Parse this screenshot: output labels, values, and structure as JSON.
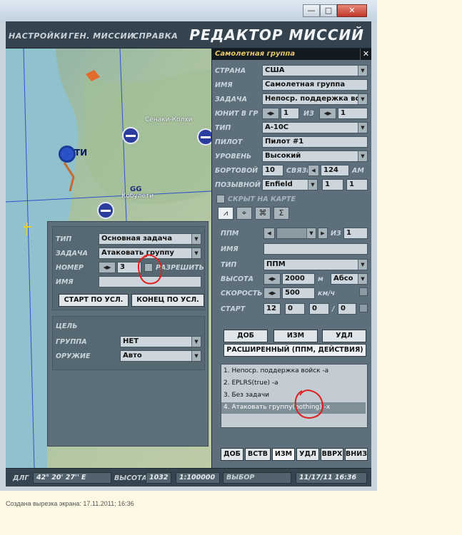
{
  "window": {
    "minimize": "—",
    "maximize": "□",
    "close": "✕"
  },
  "menu": {
    "items": [
      "НАСТРОЙКИ",
      "ГЕН. МИССИИ",
      "СПРАВКА"
    ],
    "title": "РЕДАКТОР МИССИЙ"
  },
  "map": {
    "towns": [
      "Сенаки-Колхи",
      "Кобулети"
    ],
    "airbase_code": "GG",
    "unit_code": "ТИ"
  },
  "group_panel": {
    "header": "Самолетная группа",
    "close": "✕",
    "country_label": "СТРАНА",
    "country": "США",
    "name_label": "ИМЯ",
    "name": "Самолетная группа",
    "task_label": "ЗАДАЧА",
    "task": "Непоср. поддержка войск",
    "unit_label": "ЮНИТ В ГР",
    "unit": "1",
    "of_label": "ИЗ",
    "of": "1",
    "type_label": "ТИП",
    "type": "A-10C",
    "pilot_label": "ПИЛОТ",
    "pilot": "Пилот #1",
    "level_label": "УРОВЕНЬ",
    "level": "Высокий",
    "board_label": "БОРТОВОЙ",
    "board": "10",
    "radio_label": "СВЯЗЬ",
    "radio": "124",
    "radio_unit": "AM",
    "callsign_label": "ПОЗЫВНОЙ",
    "callsign": "Enfield",
    "callsign_n1": "1",
    "callsign_n2": "1",
    "hidden_label": "СКРЫТ НА КАРТЕ",
    "tab_icons": [
      "⩘",
      "⌖",
      "⌘",
      "Σ"
    ]
  },
  "waypoint": {
    "wp_label": "ППМ",
    "of_label": "ИЗ",
    "of": "1",
    "name_label": "ИМЯ",
    "type_label": "ТИП",
    "type": "ППМ",
    "alt_label": "ВЫСОТА",
    "alt": "2000",
    "alt_unit": "м",
    "alt_mode": "Абсо",
    "speed_label": "СКОРОСТЬ",
    "speed": "500",
    "speed_unit": "км/ч",
    "start_label": "СТАРТ",
    "start_d": "12",
    "start_h": "0",
    "start_m": "0",
    "start_s": "0",
    "slash": "/"
  },
  "buttons": {
    "add": "ДОБ",
    "edit": "ИЗМ",
    "del": "УДЛ",
    "extended": "РАСШИРЕННЫЙ (ППМ, ДЕЙСТВИЯ)"
  },
  "actions": [
    "1. Непоср. поддержка войск -a",
    "2. EPLRS(true)  -a",
    "3. Без задачи",
    "4. Атаковать группу(nothing)  -x"
  ],
  "bottom_tabs": [
    "ДОБ",
    "ВСТВ",
    "ИЗМ",
    "УДЛ",
    "ВВРХ",
    "ВНИЗ"
  ],
  "action_panel": {
    "type_label": "ТИП",
    "type": "Основная задача",
    "task_label": "ЗАДАЧА",
    "task": "Атаковать группу",
    "number_label": "НОМЕР",
    "number": "3",
    "allow_label": "РАЗРЕШИТЬ",
    "name_label": "ИМЯ",
    "start_cond": "СТАРТ ПО УСЛ.",
    "end_cond": "КОНЕЦ ПО УСЛ.",
    "target_label": "ЦЕЛЬ",
    "group_label": "ГРУППА",
    "group": "НЕТ",
    "weapon_label": "ОРУЖИЕ",
    "weapon": "Авто"
  },
  "status": {
    "lon_label": "ДЛГ",
    "lon": "42° 20' 27'' E",
    "alt_label": "ВЫСОТА",
    "alt": "1032",
    "scale": "1:100000",
    "select_label": "ВЫБОР",
    "datetime": "11/17/11 16:36"
  },
  "caption": "Создана вырезка экрана: 17.11.2011; 16:36",
  "colors": {
    "map_sea": "#8fc2cc",
    "map_land": "#b3c8a3",
    "panel": "#5d6f7a",
    "header": "#e7c86b",
    "annotation": "#e02020"
  }
}
